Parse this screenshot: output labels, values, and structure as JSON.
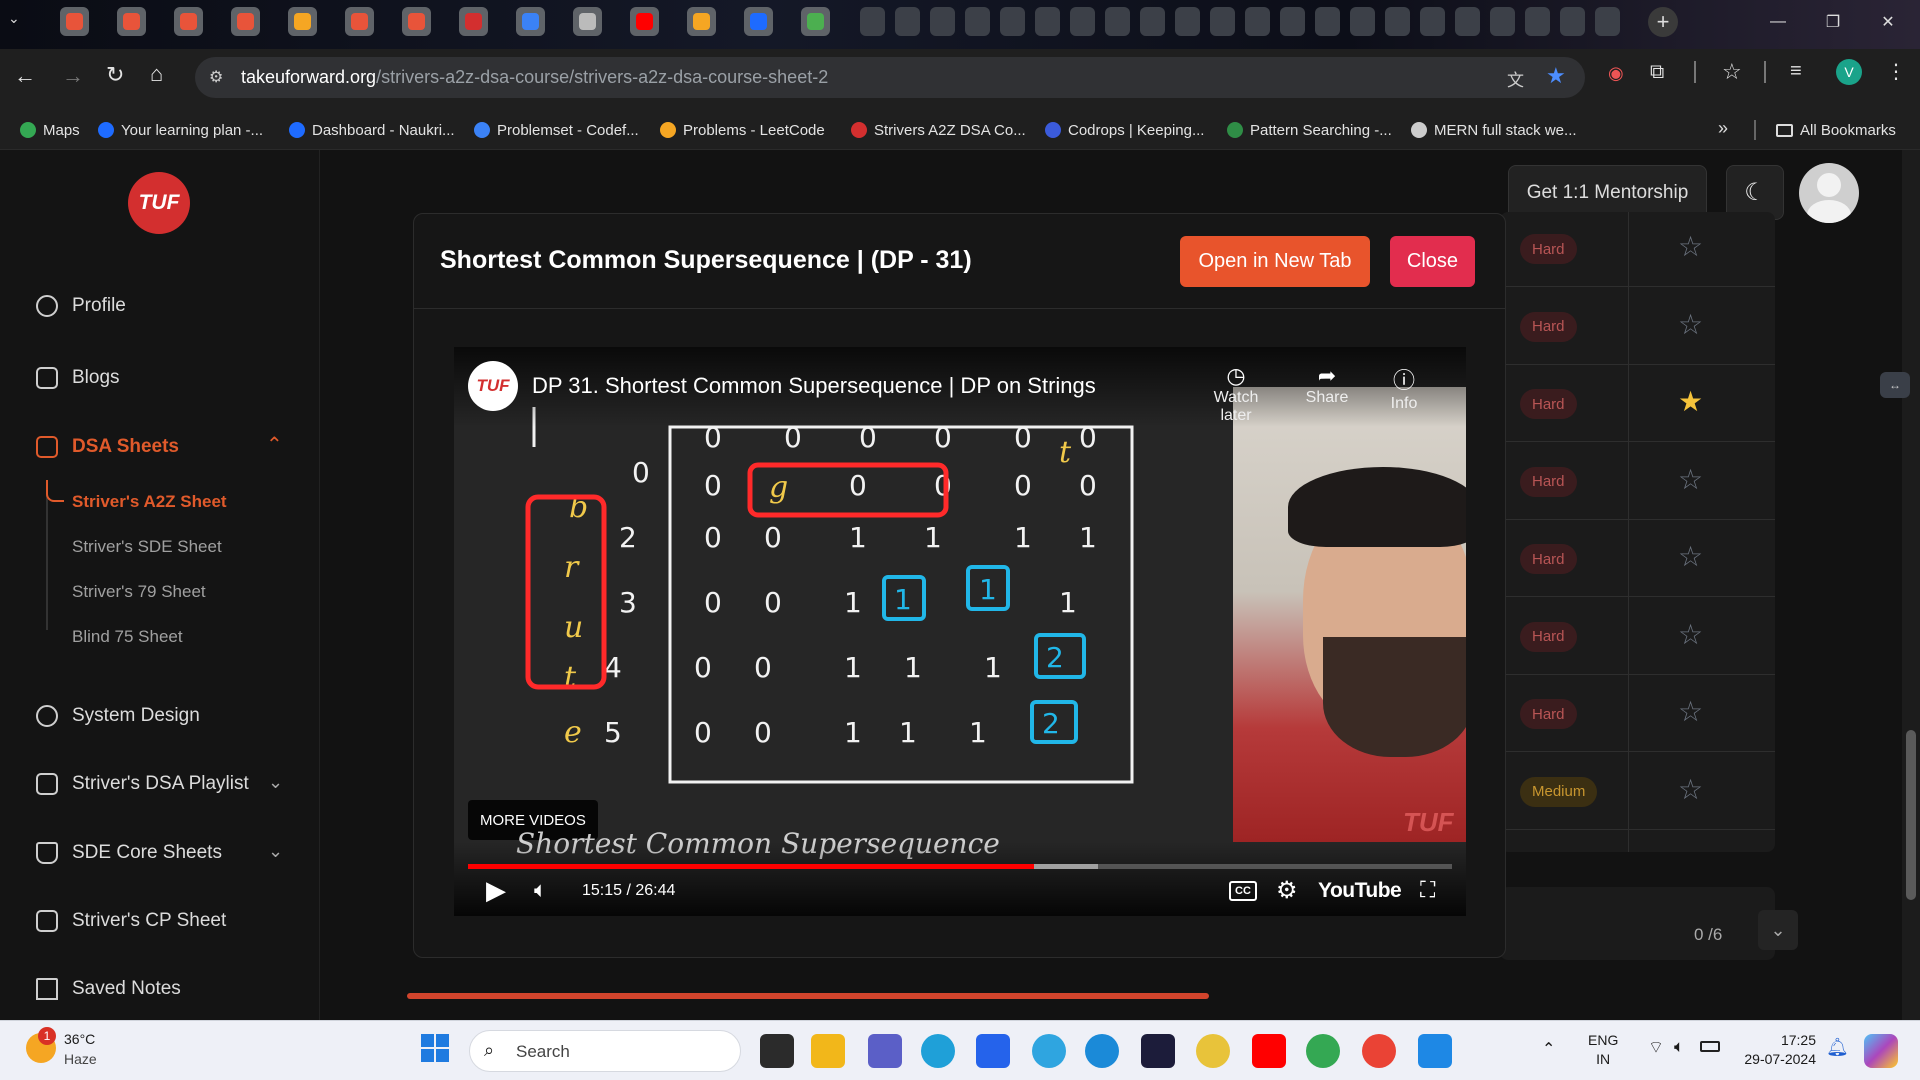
{
  "browser": {
    "tabs": [
      {
        "icon": "codeforces-icon",
        "color": "#e8543a"
      },
      {
        "icon": "codeforces-icon",
        "color": "#e8543a"
      },
      {
        "icon": "codeforces-icon",
        "color": "#e8543a"
      },
      {
        "icon": "codeforces-icon",
        "color": "#e8543a"
      },
      {
        "icon": "leetcode-icon",
        "color": "#f5a623"
      },
      {
        "icon": "codeforces-icon",
        "color": "#e8543a"
      },
      {
        "icon": "codeforces-icon",
        "color": "#e8543a"
      },
      {
        "icon": "tuf-icon",
        "color": "#d32f2f"
      },
      {
        "icon": "chart-icon",
        "color": "#3b82f6"
      },
      {
        "icon": "openai-icon",
        "color": "#bbbbbb"
      },
      {
        "icon": "youtube-icon",
        "color": "#ff0000"
      },
      {
        "icon": "leetcode-icon",
        "color": "#f5a623"
      },
      {
        "icon": "naukri-icon",
        "color": "#1e6bff"
      },
      {
        "icon": "drive-icon",
        "color": "#4caf50"
      }
    ],
    "url_host": "takeuforward.org",
    "url_path": "/strivers-a2z-dsa-course/strivers-a2z-dsa-course-sheet-2",
    "profile_letter": "V",
    "bookmarks": [
      {
        "label": "Maps",
        "color": "#34a853"
      },
      {
        "label": "Your learning plan -...",
        "color": "#1e6bff"
      },
      {
        "label": "Dashboard - Naukri...",
        "color": "#1e6bff"
      },
      {
        "label": "Problemset - Codef...",
        "color": "#3b82f6"
      },
      {
        "label": "Problems - LeetCode",
        "color": "#f5a623"
      },
      {
        "label": "Strivers A2Z DSA Co...",
        "color": "#d32f2f"
      },
      {
        "label": "Codrops | Keeping...",
        "color": "#3b5bdb"
      },
      {
        "label": "Pattern Searching -...",
        "color": "#2f8d46"
      },
      {
        "label": "MERN full stack we...",
        "color": "#cccccc"
      }
    ],
    "all_bookmarks": "All Bookmarks"
  },
  "site": {
    "logo": "TUF",
    "sidebar": {
      "profile": "Profile",
      "blogs": "Blogs",
      "dsa_sheets": "DSA Sheets",
      "subs": [
        "Striver's A2Z Sheet",
        "Striver's SDE Sheet",
        "Striver's 79 Sheet",
        "Blind 75 Sheet"
      ],
      "system_design": "System Design",
      "dsa_playlist": "Striver's DSA Playlist",
      "sde_core": "SDE Core Sheets",
      "cp_sheet": "Striver's CP Sheet",
      "saved_notes": "Saved Notes"
    },
    "mentorship": "Get 1:1 Mentorship",
    "rows": [
      {
        "difficulty": "Hard",
        "starred": false
      },
      {
        "difficulty": "Hard",
        "starred": false
      },
      {
        "difficulty": "Hard",
        "starred": true
      },
      {
        "difficulty": "Hard",
        "starred": false
      },
      {
        "difficulty": "Hard",
        "starred": false
      },
      {
        "difficulty": "Hard",
        "starred": false
      },
      {
        "difficulty": "Hard",
        "starred": false
      },
      {
        "difficulty": "Medium",
        "starred": false
      }
    ],
    "progress": "0 /6"
  },
  "modal": {
    "title": "Shortest Common Supersequence | (DP - 31)",
    "open_tab": "Open in New Tab",
    "close": "Close",
    "video": {
      "channel_logo": "TUF",
      "title": "DP 31. Shortest Common Supersequence | DP on Strings",
      "watch_later": "Watch later",
      "share": "Share",
      "info": "Info",
      "more_videos": "MORE VIDEOS",
      "time": "15:15 / 26:44",
      "progress": 0.575,
      "buffered": 0.64,
      "youtube": "YouTube",
      "watermark": "TUF",
      "handwriting_caption": "Shortest Common Supersequence"
    }
  },
  "taskbar": {
    "weather_temp": "36°C",
    "weather_desc": "Haze",
    "weather_badge": "1",
    "search": "Search",
    "lang1": "ENG",
    "lang2": "IN",
    "time": "17:25",
    "date": "29-07-2024"
  }
}
